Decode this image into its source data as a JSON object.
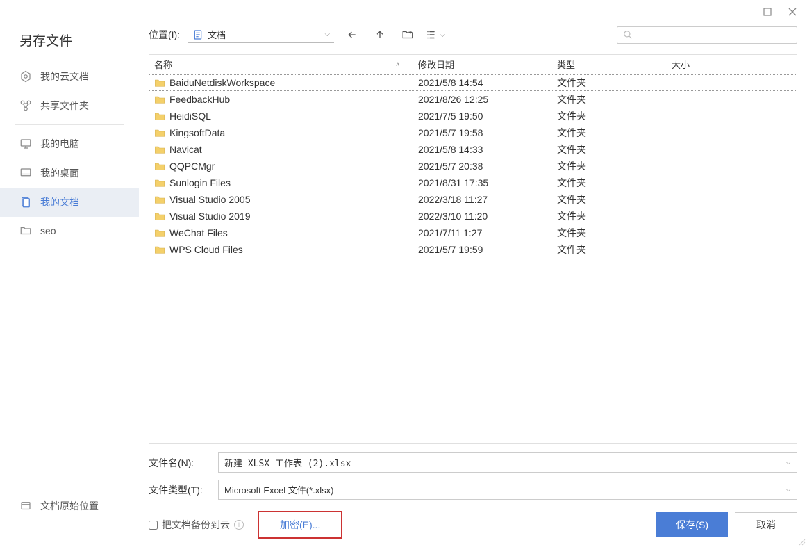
{
  "dialog": {
    "title": "另存文件"
  },
  "sidebar": {
    "items": [
      {
        "label": "我的云文档"
      },
      {
        "label": "共享文件夹"
      },
      {
        "label": "我的电脑"
      },
      {
        "label": "我的桌面"
      },
      {
        "label": "我的文档"
      },
      {
        "label": "seo"
      }
    ],
    "bottom": {
      "label": "文档原始位置"
    }
  },
  "toolbar": {
    "location_label": "位置(I):",
    "location_value": "文档"
  },
  "columns": {
    "name": "名称",
    "date": "修改日期",
    "type": "类型",
    "size": "大小"
  },
  "files": [
    {
      "name": "BaiduNetdiskWorkspace",
      "date": "2021/5/8 14:54",
      "type": "文件夹",
      "size": ""
    },
    {
      "name": "FeedbackHub",
      "date": "2021/8/26 12:25",
      "type": "文件夹",
      "size": ""
    },
    {
      "name": "HeidiSQL",
      "date": "2021/7/5 19:50",
      "type": "文件夹",
      "size": ""
    },
    {
      "name": "KingsoftData",
      "date": "2021/5/7 19:58",
      "type": "文件夹",
      "size": ""
    },
    {
      "name": "Navicat",
      "date": "2021/5/8 14:33",
      "type": "文件夹",
      "size": ""
    },
    {
      "name": "QQPCMgr",
      "date": "2021/5/7 20:38",
      "type": "文件夹",
      "size": ""
    },
    {
      "name": "Sunlogin Files",
      "date": "2021/8/31 17:35",
      "type": "文件夹",
      "size": ""
    },
    {
      "name": "Visual Studio 2005",
      "date": "2022/3/18 11:27",
      "type": "文件夹",
      "size": ""
    },
    {
      "name": "Visual Studio 2019",
      "date": "2022/3/10 11:20",
      "type": "文件夹",
      "size": ""
    },
    {
      "name": "WeChat Files",
      "date": "2021/7/11 1:27",
      "type": "文件夹",
      "size": ""
    },
    {
      "name": "WPS Cloud Files",
      "date": "2021/5/7 19:59",
      "type": "文件夹",
      "size": ""
    }
  ],
  "fields": {
    "filename_label": "文件名(N):",
    "filename_value": "新建 XLSX 工作表 (2).xlsx",
    "filetype_label": "文件类型(T):",
    "filetype_value": "Microsoft Excel 文件(*.xlsx)"
  },
  "actions": {
    "backup_label": "把文档备份到云",
    "encrypt_label": "加密(E)...",
    "save_label": "保存(S)",
    "cancel_label": "取消"
  }
}
